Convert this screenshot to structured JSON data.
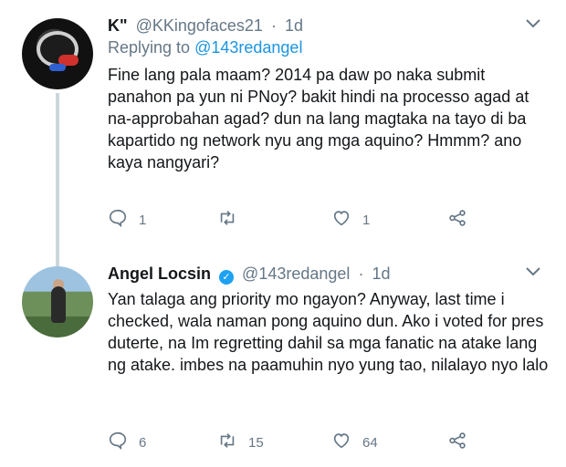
{
  "tweets": [
    {
      "name": "K\"",
      "handle": "@KKingofaces21",
      "time": "1d",
      "replying_prefix": "Replying to",
      "replying_to": "@143redangel",
      "text": "Fine lang pala maam? 2014 pa daw po naka submit panahon pa yun ni PNoy? bakit hindi na processo agad at na-approbahan agad? dun na lang magtaka na tayo di ba kapartido ng network nyu ang mga aquino? Hmmm? ano kaya nangyari?",
      "replies": "1",
      "retweets": "",
      "likes": "1"
    },
    {
      "name": "Angel Locsin",
      "verified": true,
      "handle": "@143redangel",
      "time": "1d",
      "text": "Yan talaga ang priority mo ngayon? Anyway, last time i checked, wala naman pong aquino dun. Ako i voted for pres duterte, na Im regretting dahil sa mga fanatic na atake lang ng atake. imbes na paamuhin nyo yung tao, nilalayo nyo lalo",
      "replies": "6",
      "retweets": "15",
      "likes": "64"
    }
  ],
  "separator": "·",
  "colors": {
    "link": "#1b95e0",
    "muted": "#657786",
    "verified": "#1da1f2"
  },
  "icons": [
    "reply-icon",
    "retweet-icon",
    "like-icon",
    "share-icon",
    "chevron-down-icon",
    "verified-icon"
  ]
}
